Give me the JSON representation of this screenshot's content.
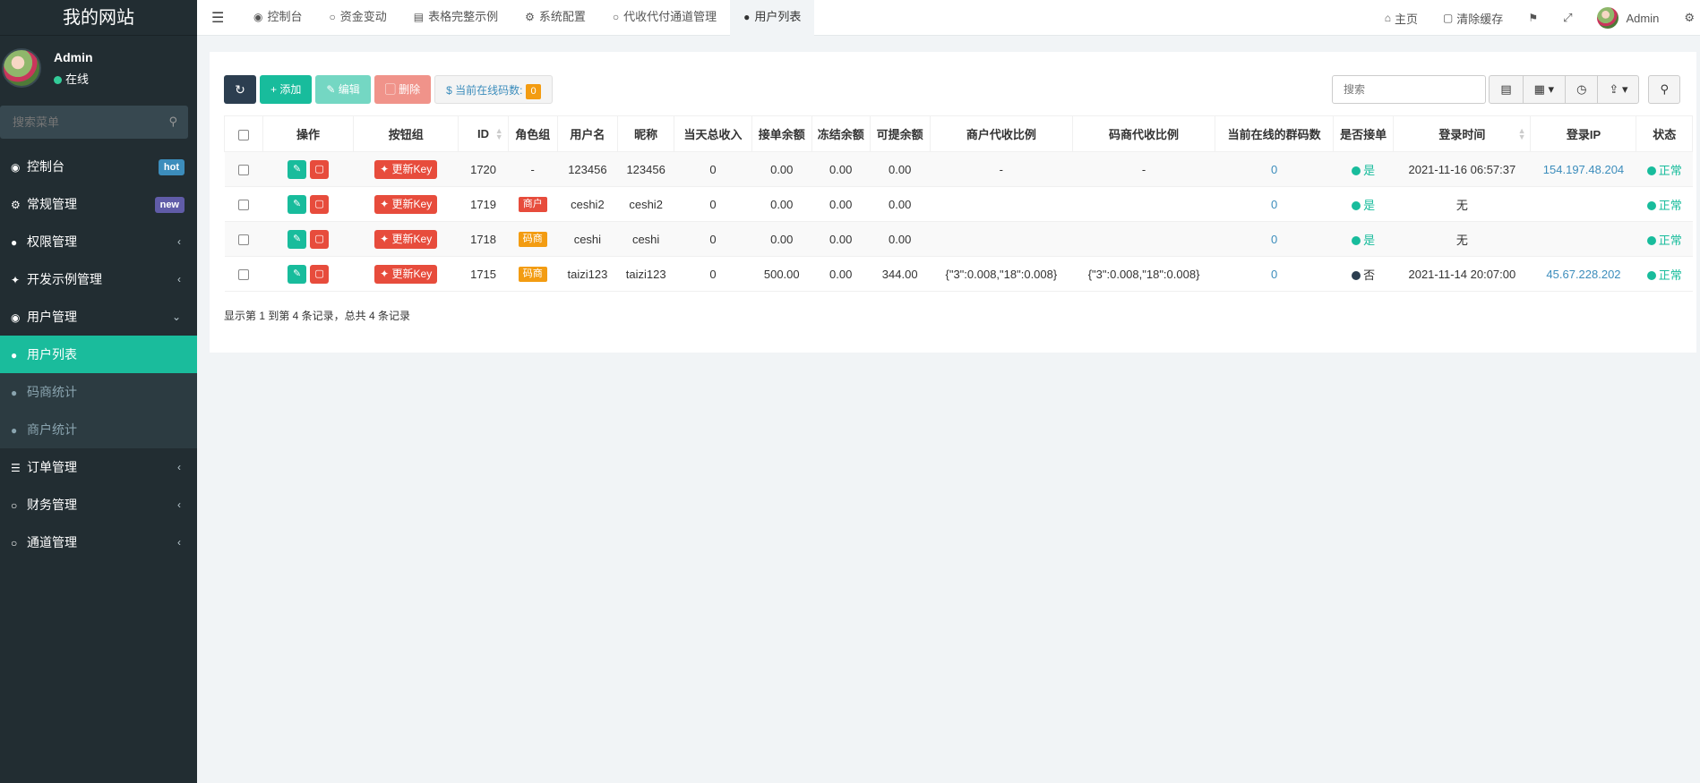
{
  "site": {
    "title": "我的网站"
  },
  "user": {
    "name": "Admin",
    "status": "在线"
  },
  "sidebar": {
    "search_placeholder": "搜索菜单",
    "items": [
      {
        "label": "控制台",
        "icon": "dashboard-icon",
        "badge": "hot"
      },
      {
        "label": "常规管理",
        "icon": "cogs-icon",
        "badge": "new"
      },
      {
        "label": "权限管理",
        "icon": "users-icon"
      },
      {
        "label": "开发示例管理",
        "icon": "magic-icon"
      },
      {
        "label": "用户管理",
        "icon": "user-circle-icon"
      },
      {
        "label": "订单管理",
        "icon": "list-icon"
      },
      {
        "label": "财务管理",
        "icon": "circle-icon"
      },
      {
        "label": "通道管理",
        "icon": "circle-icon"
      }
    ],
    "submenu": [
      {
        "label": "用户列表",
        "active": true
      },
      {
        "label": "码商统计"
      },
      {
        "label": "商户统计"
      }
    ]
  },
  "tabs": [
    {
      "label": "控制台"
    },
    {
      "label": "资金变动"
    },
    {
      "label": "表格完整示例"
    },
    {
      "label": "系统配置"
    },
    {
      "label": "代收代付通道管理"
    },
    {
      "label": "用户列表",
      "active": true
    }
  ],
  "topright": {
    "home": "主页",
    "clear_cache": "清除缓存",
    "admin": "Admin"
  },
  "toolbar": {
    "add": "添加",
    "edit": "编辑",
    "delete": "删除",
    "online_label": "当前在线码数:",
    "online_count": "0",
    "search_placeholder": "搜索"
  },
  "table": {
    "headers": [
      "操作",
      "按钮组",
      "ID",
      "角色组",
      "用户名",
      "昵称",
      "当天总收入",
      "接单余额",
      "冻结余额",
      "可提余额",
      "商户代收比例",
      "码商代收比例",
      "当前在线的群码数",
      "是否接单",
      "登录时间",
      "登录IP",
      "状态"
    ],
    "key_label": "更新Key",
    "rows": [
      {
        "id": "1720",
        "role": "-",
        "role_type": "none",
        "username": "123456",
        "nickname": "123456",
        "income": "0",
        "order_balance": "0.00",
        "frozen": "0.00",
        "withdrawable": "0.00",
        "merchant_ratio": "-",
        "code_ratio": "-",
        "online_codes": "0",
        "accept": "是",
        "accept_on": true,
        "login_time": "2021-11-16 06:57:37",
        "login_ip": "154.197.48.204",
        "status": "正常"
      },
      {
        "id": "1719",
        "role": "商户",
        "role_type": "merchant",
        "username": "ceshi2",
        "nickname": "ceshi2",
        "income": "0",
        "order_balance": "0.00",
        "frozen": "0.00",
        "withdrawable": "0.00",
        "merchant_ratio": "",
        "code_ratio": "",
        "online_codes": "0",
        "accept": "是",
        "accept_on": true,
        "login_time": "无",
        "login_ip": "",
        "status": "正常"
      },
      {
        "id": "1718",
        "role": "码商",
        "role_type": "code",
        "username": "ceshi",
        "nickname": "ceshi",
        "income": "0",
        "order_balance": "0.00",
        "frozen": "0.00",
        "withdrawable": "0.00",
        "merchant_ratio": "",
        "code_ratio": "",
        "online_codes": "0",
        "accept": "是",
        "accept_on": true,
        "login_time": "无",
        "login_ip": "",
        "status": "正常"
      },
      {
        "id": "1715",
        "role": "码商",
        "role_type": "code",
        "username": "taizi123",
        "nickname": "taizi123",
        "income": "0",
        "order_balance": "500.00",
        "frozen": "0.00",
        "withdrawable": "344.00",
        "merchant_ratio": "{\"3\":0.008,\"18\":0.008}",
        "code_ratio": "{\"3\":0.008,\"18\":0.008}",
        "online_codes": "0",
        "accept": "否",
        "accept_on": false,
        "login_time": "2021-11-14 20:07:00",
        "login_ip": "45.67.228.202",
        "status": "正常"
      }
    ],
    "footer": "显示第 1 到第 4 条记录，总共 4 条记录"
  }
}
